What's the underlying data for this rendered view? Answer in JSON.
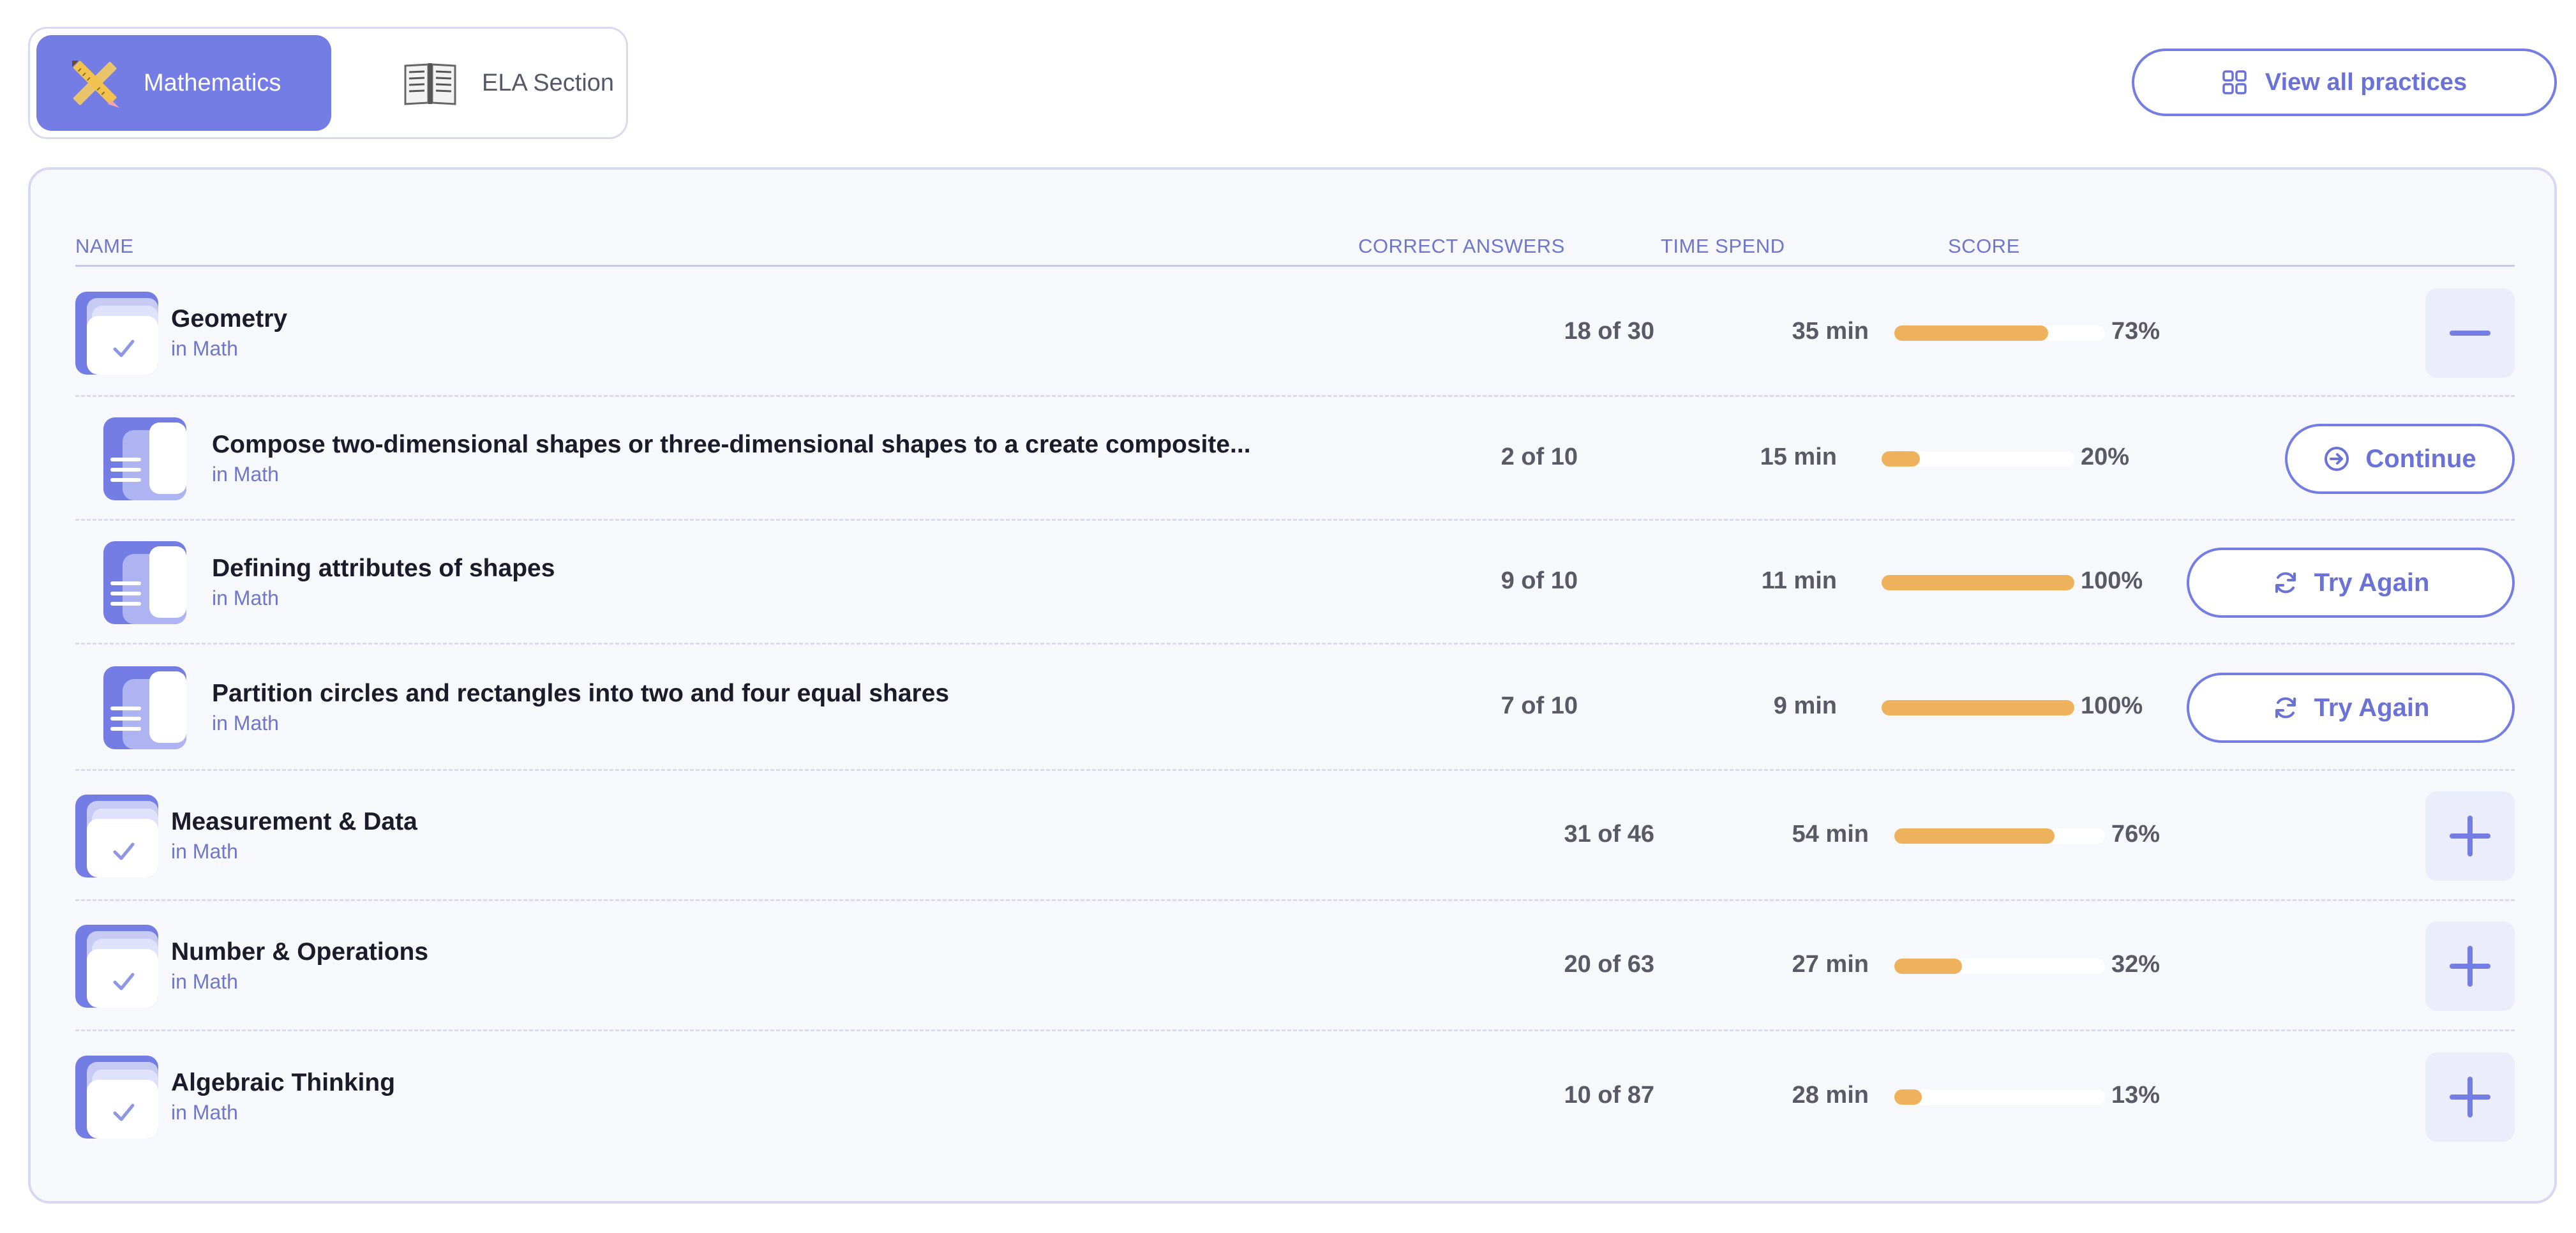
{
  "subjects": [
    {
      "label": "Mathematics",
      "icon": "pencil-ruler-icon",
      "active": true
    },
    {
      "label": "ELA Section",
      "icon": "book-icon",
      "active": false
    }
  ],
  "view_all": {
    "label": "View all practices",
    "icon": "grid-icon"
  },
  "table": {
    "headers": {
      "name": "NAME",
      "correct": "CORRECT ANSWERS",
      "time": "TIME SPEND",
      "score": "SCORE"
    }
  },
  "rows": [
    {
      "kind": "parent",
      "title": "Geometry",
      "subtitle": "in Math",
      "correct": "18 of 30",
      "time": "35 min",
      "score_pct": 73,
      "score_label": "73%",
      "toggle": "collapse",
      "icon": "checklist-folder-icon"
    },
    {
      "kind": "sub",
      "title": "Compose two-dimensional shapes or three-dimensional shapes to a create composite...",
      "subtitle": "in Math",
      "correct": "2 of 10",
      "time": "15 min",
      "score_pct": 20,
      "score_label": "20%",
      "action": "Continue",
      "action_icon": "arrow-circle-right-icon",
      "icon": "document-list-icon"
    },
    {
      "kind": "sub",
      "title": "Defining attributes of shapes",
      "subtitle": "in Math",
      "correct": "9 of 10",
      "time": "11 min",
      "score_pct": 100,
      "score_label": "100%",
      "action": "Try Again",
      "action_icon": "refresh-icon",
      "icon": "document-list-icon"
    },
    {
      "kind": "sub",
      "title": "Partition circles and rectangles into two and four equal shares",
      "subtitle": "in Math",
      "correct": "7 of 10",
      "time": "9 min",
      "score_pct": 100,
      "score_label": "100%",
      "action": "Try Again",
      "action_icon": "refresh-icon",
      "icon": "document-list-icon"
    },
    {
      "kind": "parent",
      "title": "Measurement & Data",
      "subtitle": "in Math",
      "correct": "31 of 46",
      "time": "54 min",
      "score_pct": 76,
      "score_label": "76%",
      "toggle": "expand",
      "icon": "checklist-folder-icon"
    },
    {
      "kind": "parent",
      "title": "Number & Operations",
      "subtitle": "in Math",
      "correct": "20 of 63",
      "time": "27 min",
      "score_pct": 32,
      "score_label": "32%",
      "toggle": "expand",
      "icon": "checklist-folder-icon"
    },
    {
      "kind": "parent",
      "title": "Algebraic Thinking",
      "subtitle": "in Math",
      "correct": "10 of 87",
      "time": "28 min",
      "score_pct": 13,
      "score_label": "13%",
      "toggle": "expand",
      "icon": "checklist-folder-icon"
    }
  ],
  "colors": {
    "accent": "#747de3",
    "progress": "#efb25c",
    "panel_bg": "#f7f8fc"
  }
}
